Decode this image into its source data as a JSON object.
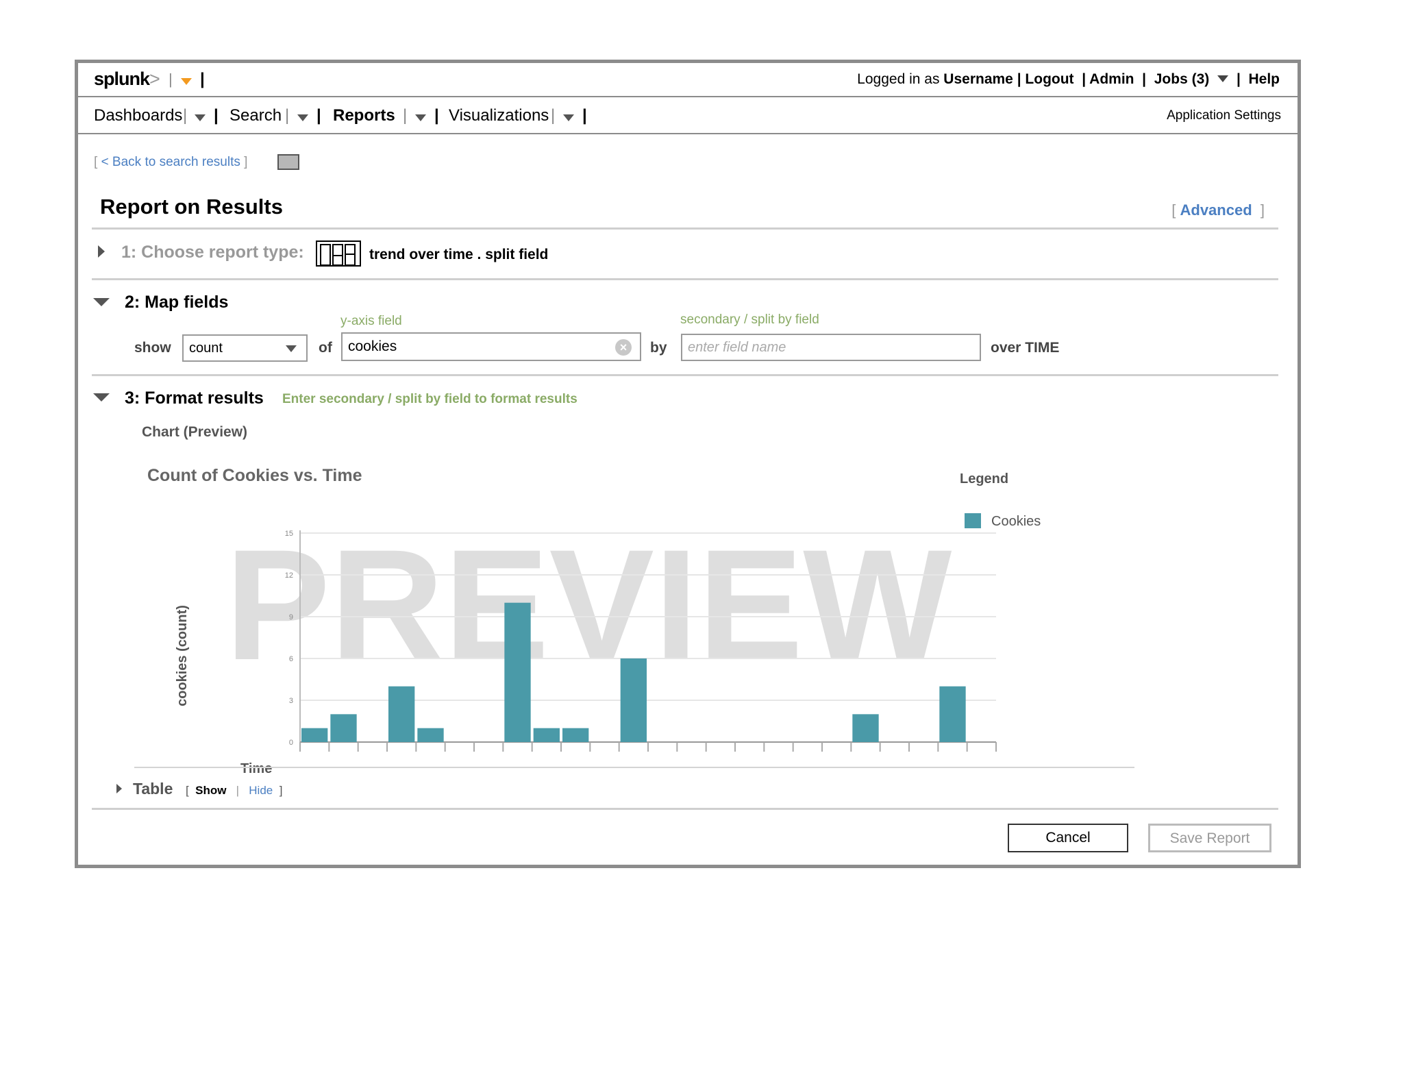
{
  "header": {
    "logo_text": "splunk",
    "logo_suffix": ">",
    "logged_in_prefix": "Logged in as",
    "username": "Username",
    "logout": "Logout",
    "admin": "Admin",
    "jobs": "Jobs (3)",
    "help": "Help"
  },
  "nav": {
    "items": [
      {
        "label": "Dashboards"
      },
      {
        "label": "Search"
      },
      {
        "label": "Reports"
      },
      {
        "label": "Visualizations"
      }
    ],
    "app_settings": "Application Settings"
  },
  "back_link": "< Back to search results",
  "page_title": "Report on Results",
  "advanced": "Advanced",
  "step1": {
    "title": "1: Choose report type:",
    "value": "trend over time . split field"
  },
  "step2": {
    "title": "2: Map fields",
    "show_label": "show",
    "show_value": "count",
    "of_label": "of",
    "yaxis_caption": "y-axis field",
    "yaxis_value": "cookies",
    "by_label": "by",
    "split_caption": "secondary / split by field",
    "split_placeholder": "enter field name",
    "over_time": "over TIME"
  },
  "step3": {
    "title": "3: Format results",
    "hint": "Enter secondary / split by field to format results",
    "chart_preview_label": "Chart (Preview)"
  },
  "chart_data": {
    "type": "bar",
    "title": "Count of Cookies vs. Time",
    "xlabel": "Time",
    "ylabel": "cookies (count)",
    "ylim": [
      0,
      15
    ],
    "yticks": [
      "0",
      "3",
      "6",
      "9",
      "12",
      "15"
    ],
    "watermark": "PREVIEW",
    "legend_title": "Legend",
    "legend_position": "top-right",
    "series": [
      {
        "name": "Cookies",
        "color": "#4a9aa8"
      }
    ],
    "slots": 24,
    "bars": [
      {
        "slot": 0,
        "value": 1
      },
      {
        "slot": 1,
        "value": 2
      },
      {
        "slot": 3,
        "value": 4
      },
      {
        "slot": 4,
        "value": 1
      },
      {
        "slot": 7,
        "value": 10
      },
      {
        "slot": 8,
        "value": 1
      },
      {
        "slot": 9,
        "value": 1
      },
      {
        "slot": 11,
        "value": 6
      },
      {
        "slot": 19,
        "value": 2
      },
      {
        "slot": 22,
        "value": 4
      }
    ]
  },
  "table_section": {
    "label": "Table",
    "show": "Show",
    "hide": "Hide"
  },
  "buttons": {
    "cancel": "Cancel",
    "save": "Save Report"
  },
  "colors": {
    "border": "#8c8c8c",
    "accent_orange": "#f39a1f",
    "green_text": "#8aab66",
    "link_blue": "#4b7fc2",
    "bar": "#4a9aa8"
  }
}
